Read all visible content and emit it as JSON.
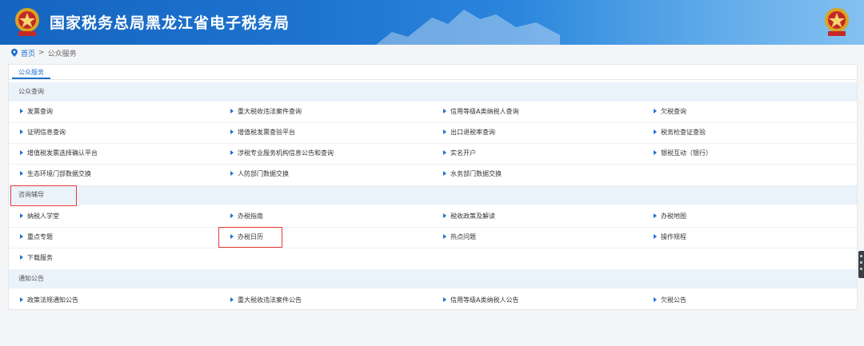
{
  "header": {
    "title": "国家税务总局黑龙江省电子税务局",
    "colors": {
      "banner": "#1565c0",
      "accent": "#1f6fd1",
      "highlight": "#e53935"
    }
  },
  "breadcrumb": {
    "home": "首页",
    "separator": ">",
    "current": "公众服务"
  },
  "tabs": [
    {
      "label": "公众服务"
    }
  ],
  "sections": [
    {
      "title": "公众查询",
      "items": [
        "发票查询",
        "重大税收违法案件查询",
        "信用等级A类纳税人查询",
        "欠税查询",
        "证明信息查询",
        "增值税发票查验平台",
        "出口退税率查询",
        "税务检查证查验",
        "增值税发票选择确认平台",
        "涉税专业服务机构信息公告和查询",
        "实名开户",
        "银税互动（银行）",
        "生态环境门部数据交换",
        "人防部门数据交换",
        "水务部门数据交换"
      ]
    },
    {
      "title": "咨询辅导",
      "items": [
        "纳税人学堂",
        "办税指南",
        "税收政策及解读",
        "办税地图",
        "重点专题",
        "办税日历",
        "热点问题",
        "操作规程",
        "下载服务"
      ]
    },
    {
      "title": "通知公告",
      "items": [
        "政策法规通知公告",
        "重大税收违法案件公告",
        "信用等级A类纳税人公告",
        "欠税公告"
      ]
    }
  ]
}
